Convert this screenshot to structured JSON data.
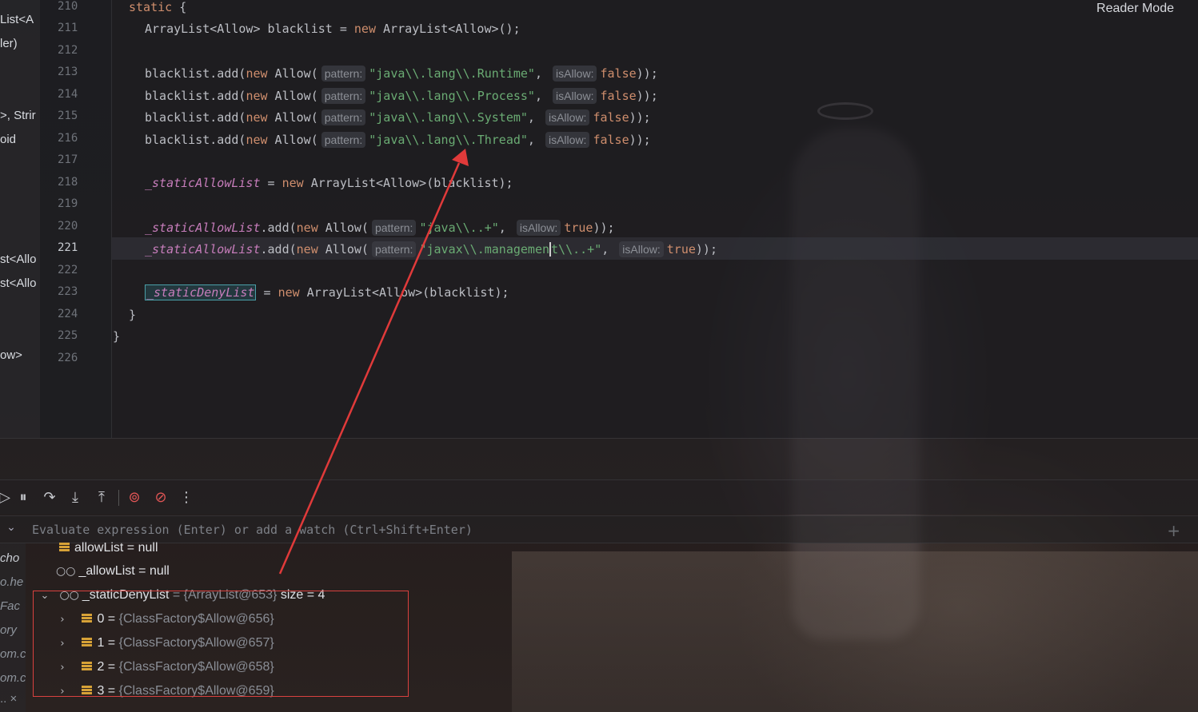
{
  "editor": {
    "reader_mode": "Reader Mode",
    "line_numbers": [
      "210",
      "211",
      "212",
      "213",
      "214",
      "215",
      "216",
      "217",
      "218",
      "219",
      "220",
      "221",
      "222",
      "223",
      "224",
      "225",
      "226"
    ],
    "active_line": "221",
    "hints": {
      "pattern": "pattern:",
      "is_allow": "isAllow:"
    },
    "code": {
      "l210_kw": "static",
      "l210_rest": " {",
      "l211_a": "ArrayList<Allow> blacklist = ",
      "l211_kw": "new",
      "l211_b": " ArrayList<Allow>();",
      "add_prefix": "blacklist.add(",
      "new": "new",
      "allow_open": " Allow(",
      "s213": "\"java\\\\.lang\\\\.Runtime\"",
      "s214": "\"java\\\\.lang\\\\.Process\"",
      "s215": "\"java\\\\.lang\\\\.System\"",
      "s216": "\"java\\\\.lang\\\\.Thread\"",
      "comma": ",",
      "false": "false",
      "true": "true",
      "close": "));",
      "f_static_allow": "_staticAllowList",
      "f_static_deny": "_staticDenyList",
      "l218_rest": " = ",
      "l218_b": " ArrayList<Allow>(blacklist);",
      "dot_add": ".add(",
      "s220": "\"java\\\\..+\"",
      "s221_a": "\"javax\\\\.managemen",
      "s221_b": "t\\\\..+\"",
      "l223_b": " ArrayList<Allow>(blacklist);",
      "l224": "}",
      "l225": "}"
    }
  },
  "left_panel": {
    "frag1": "List<A",
    "frag2": "ler)",
    "frag3": ">, Strir",
    "frag4": "oid",
    "frag5": "st<Allo",
    "frag6": "st<Allo",
    "frag7": "ow>"
  },
  "debug": {
    "toolbar_icons": [
      "resume-icon",
      "pause-icon",
      "step-over-icon",
      "step-into-icon",
      "step-out-icon",
      "view-breakpoints-icon",
      "mute-breakpoints-icon",
      "more-icon"
    ],
    "eval_placeholder": "Evaluate expression (Enter) or add a watch (Ctrl+Shift+Enter)",
    "frames": [
      "cho",
      "o.he",
      "Fac",
      "ory",
      "om.c",
      "om.c",
      ".. ×"
    ],
    "variables": [
      {
        "name": "allowList",
        "value": " = null"
      },
      {
        "name": "_allowList",
        "value": " = null"
      },
      {
        "name": "_staticDenyList",
        "ref": " = {ArrayList@653}",
        "extra": "  size = 4"
      },
      {
        "name": "0",
        "ref": "{ClassFactory$Allow@656}"
      },
      {
        "name": "1",
        "ref": "{ClassFactory$Allow@657}"
      },
      {
        "name": "2",
        "ref": "{ClassFactory$Allow@658}"
      },
      {
        "name": "3",
        "ref": "{ClassFactory$Allow@659}"
      }
    ],
    "eq": " = "
  },
  "annotation": {
    "color": "#e03a3a"
  }
}
